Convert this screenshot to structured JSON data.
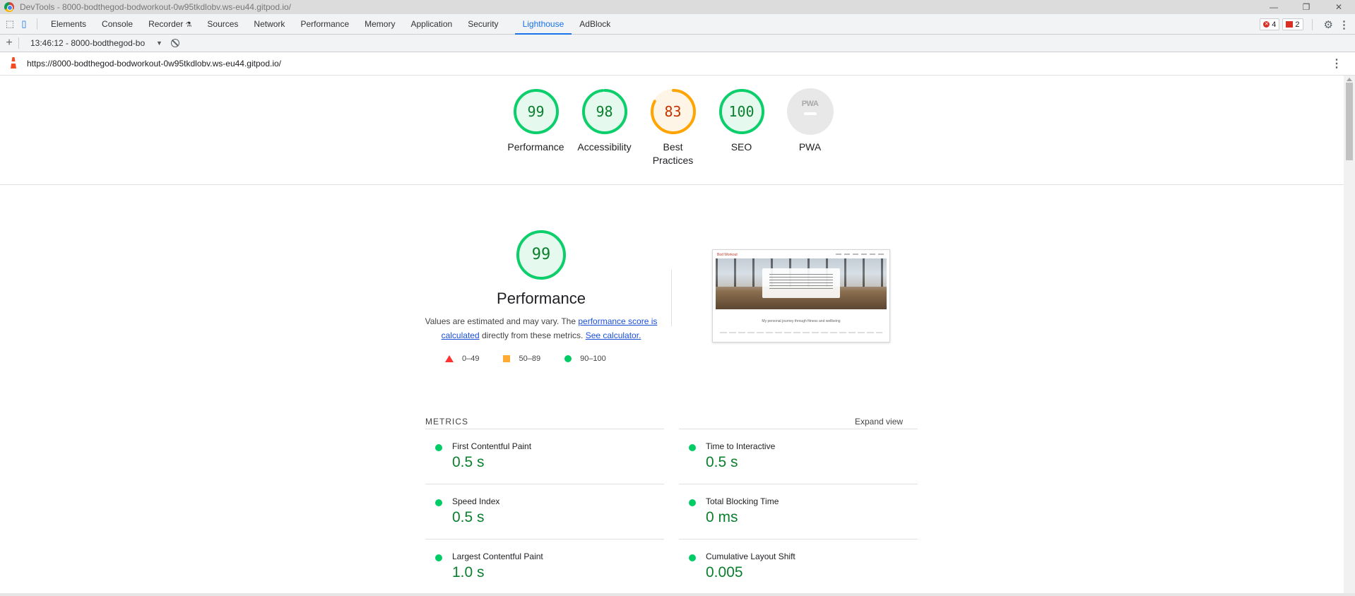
{
  "window": {
    "title": "DevTools - 8000-bodthegod-bodworkout-0w95tkdlobv.ws-eu44.gitpod.io/"
  },
  "devtools": {
    "tabs": [
      {
        "label": "Elements"
      },
      {
        "label": "Console"
      },
      {
        "label": "Recorder"
      },
      {
        "label": "Sources"
      },
      {
        "label": "Network"
      },
      {
        "label": "Performance"
      },
      {
        "label": "Memory"
      },
      {
        "label": "Application"
      },
      {
        "label": "Security"
      },
      {
        "label": "Lighthouse",
        "active": true
      },
      {
        "label": "AdBlock"
      }
    ],
    "errors_count": "4",
    "issues_count": "2"
  },
  "toolbar": {
    "report_selector": "13:46:12 - 8000-bodthegod-bo"
  },
  "report": {
    "url": "https://8000-bodthegod-bodworkout-0w95tkdlobv.ws-eu44.gitpod.io/",
    "categories": [
      {
        "score": "99",
        "label": "Performance",
        "value": 0.99,
        "color": "#0cce6b"
      },
      {
        "score": "98",
        "label": "Accessibility",
        "value": 0.98,
        "color": "#0cce6b"
      },
      {
        "score": "83",
        "label": "Best\nPractices",
        "value": 0.83,
        "color": "#ffa400"
      },
      {
        "score": "100",
        "label": "SEO",
        "value": 1.0,
        "color": "#0cce6b"
      }
    ],
    "pwa": {
      "logo_text": "PWA",
      "label": "PWA"
    },
    "performance": {
      "score": "99",
      "title": "Performance",
      "desc_prefix": "Values are estimated and may vary. The ",
      "desc_link1": "performance score is calculated",
      "desc_mid": " directly from these metrics. ",
      "desc_link2": "See calculator."
    },
    "legend": [
      {
        "range": "0–49"
      },
      {
        "range": "50–89"
      },
      {
        "range": "90–100"
      }
    ],
    "screenshot": {
      "brand": "Bod Workout",
      "caption": "My personal journey through fitness and wellbeing"
    },
    "metrics_header": "METRICS",
    "expand_view": "Expand view",
    "metrics": [
      {
        "name": "First Contentful Paint",
        "value": "0.5 s"
      },
      {
        "name": "Time to Interactive",
        "value": "0.5 s"
      },
      {
        "name": "Speed Index",
        "value": "0.5 s"
      },
      {
        "name": "Total Blocking Time",
        "value": "0 ms"
      },
      {
        "name": "Largest Contentful Paint",
        "value": "1.0 s"
      },
      {
        "name": "Cumulative Layout Shift",
        "value": "0.005"
      }
    ],
    "colors": {
      "pass": "#0cce6b",
      "average": "#ffa400",
      "fail": "#ff3333"
    }
  }
}
